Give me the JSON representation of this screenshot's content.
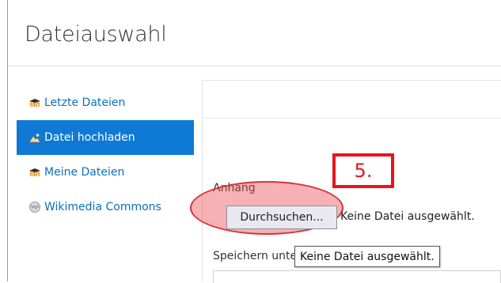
{
  "dialog": {
    "title": "Dateiauswahl"
  },
  "sidebar": {
    "items": [
      {
        "label": "Letzte Dateien",
        "icon": "moodle-icon",
        "active": false
      },
      {
        "label": "Datei hochladen",
        "icon": "upload-icon",
        "active": true
      },
      {
        "label": "Meine Dateien",
        "icon": "moodle-icon",
        "active": false
      },
      {
        "label": "Wikimedia Commons",
        "icon": "wikimedia-icon",
        "active": false
      }
    ]
  },
  "upload": {
    "attachment_label": "Anhang",
    "browse_label": "Durchsuchen...",
    "file_status": "Keine Datei ausgewählt.",
    "save_as_label": "Speichern unter",
    "tooltip": "Keine Datei ausgewählt."
  },
  "annotation": {
    "step": "5.",
    "color": "#e8141b"
  },
  "colors": {
    "active_bg": "#0f7ad6",
    "link": "#0a6fbf"
  }
}
